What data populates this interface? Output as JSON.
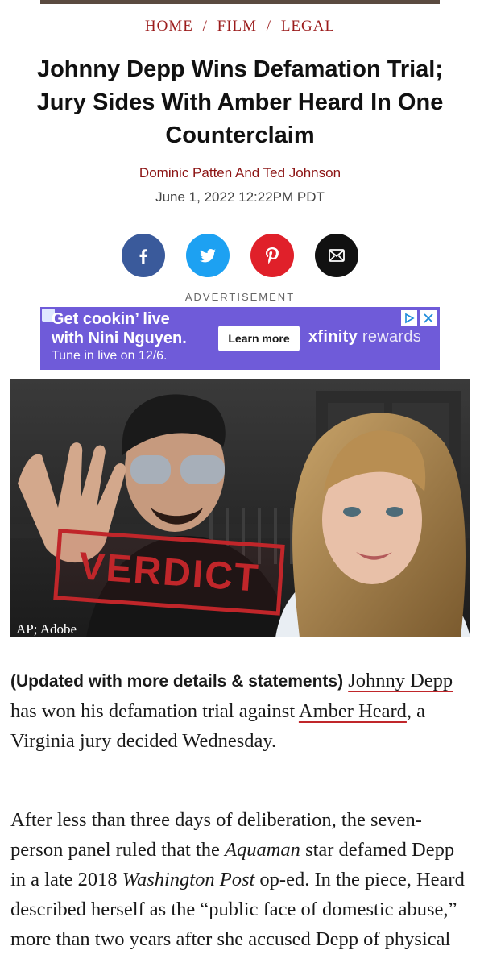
{
  "breadcrumb": {
    "items": [
      "HOME",
      "FILM",
      "LEGAL"
    ],
    "separator": "/"
  },
  "article": {
    "title": "Johnny Depp Wins Defamation Trial; Jury Sides With Amber Heard In One Counterclaim",
    "byline": "Dominic Patten And Ted Johnson",
    "date": "June 1, 2022 12:22PM PDT",
    "image_credit": "AP; Adobe",
    "image_stamp": "VERDICT",
    "p1": {
      "lead": "(Updated with more details & statements)",
      "link1": "Johnny Depp",
      "mid": " has won his defamation trial against ",
      "link2": "Amber Heard",
      "end": ", a Virginia jury decided Wednesday."
    },
    "p2": {
      "t1": "After less than three days of deliberation, the seven-person panel ruled that the ",
      "i1": "Aquaman",
      "t2": " star defamed Depp in a late 2018 ",
      "i2": "Washington Post",
      "t3": " op-ed. In the piece, Heard described herself as the “public face of domestic abuse,” more than two years after she accused Depp of physical"
    }
  },
  "share": {
    "facebook": "facebook-icon",
    "twitter": "twitter-icon",
    "pinterest": "pinterest-icon",
    "email": "email-icon"
  },
  "ad": {
    "label": "ADVERTISEMENT",
    "line1": "Get cookin’ live",
    "line2": "with Nini Nguyen.",
    "line3": "Tune in live on 12/6.",
    "cta": "Learn more",
    "brand_name": "xfinity",
    "brand_sub": "rewards"
  },
  "colors": {
    "accent": "#9b1b1b",
    "facebook": "#3a5a9b",
    "twitter": "#1da1f2",
    "pinterest": "#e0202a",
    "ad_bg": "#6f5bd9"
  }
}
